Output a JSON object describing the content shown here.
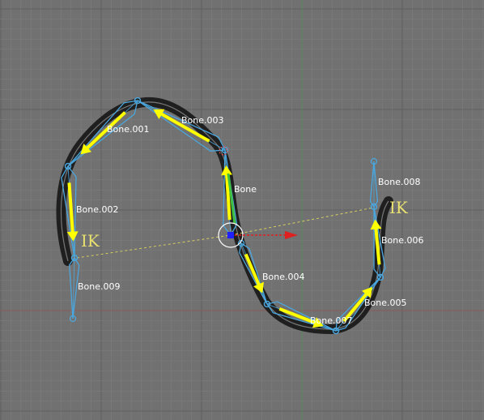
{
  "viewport": {
    "background": "#717171",
    "grid_minor_color": "#7a7a7a",
    "grid_major_color": "#5e5e5e",
    "x_axis_color": "#8a5a5a",
    "y_axis_color": "#5a8a5a"
  },
  "mesh": {
    "color": "#111111"
  },
  "armature": {
    "bone_color": "#4aa6dd",
    "arrow_color": "#ffff00",
    "label_color": "#ffffff",
    "ik_color": "#e8e070",
    "ik_line_color": "#d8d060",
    "ik_label": "IK",
    "bone_labels": [
      "Bone.001",
      "Bone.002",
      "Bone.003",
      "Bone",
      "Bone.004",
      "Bone.005",
      "Bone.006",
      "Bone.007",
      "Bone.008",
      "Bone.009"
    ]
  },
  "manipulator": {
    "x_axis_color": "#e02020",
    "center_color": "#2020ff",
    "ring_color": "#ffffff"
  }
}
